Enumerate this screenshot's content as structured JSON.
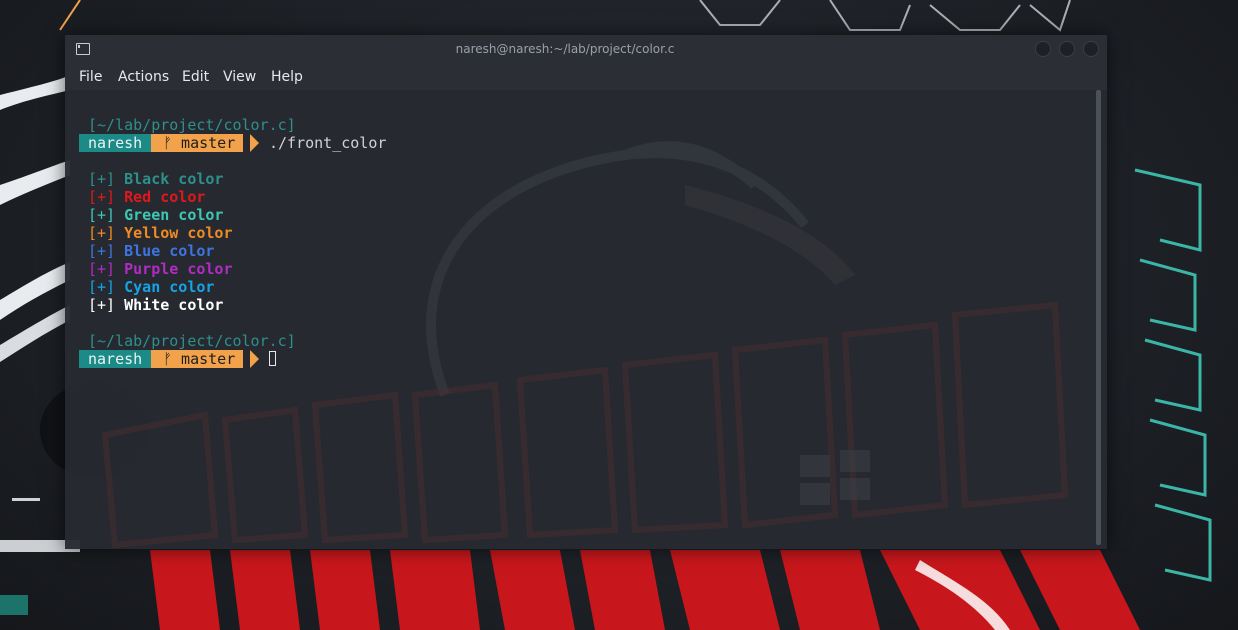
{
  "window": {
    "title": "naresh@naresh:~/lab/project/color.c"
  },
  "menu": {
    "file": "File",
    "actions": "Actions",
    "edit": "Edit",
    "view": "View",
    "help": "Help"
  },
  "terminal": {
    "prompt1": {
      "path": "[~/lab/project/color.c]",
      "user": "naresh",
      "branch_icon": "ᚠ",
      "branch": "master",
      "command": "./front_color"
    },
    "output": [
      {
        "marker": "[+]",
        "text": "Black color",
        "color": "#2f8f8c"
      },
      {
        "marker": "[+]",
        "text": "Red color",
        "color": "#e0181c"
      },
      {
        "marker": "[+]",
        "text": "Green color",
        "color": "#3fc7b5"
      },
      {
        "marker": "[+]",
        "text": "Yellow color",
        "color": "#f08a24"
      },
      {
        "marker": "[+]",
        "text": "Blue color",
        "color": "#3f74e0"
      },
      {
        "marker": "[+]",
        "text": "Purple color",
        "color": "#b02cc4"
      },
      {
        "marker": "[+]",
        "text": "Cyan color",
        "color": "#16a3e6"
      },
      {
        "marker": "[+]",
        "text": "White color",
        "color": "#ffffff"
      }
    ],
    "prompt2": {
      "path": "[~/lab/project/color.c]",
      "user": "naresh",
      "branch_icon": "ᚠ",
      "branch": "master"
    }
  }
}
